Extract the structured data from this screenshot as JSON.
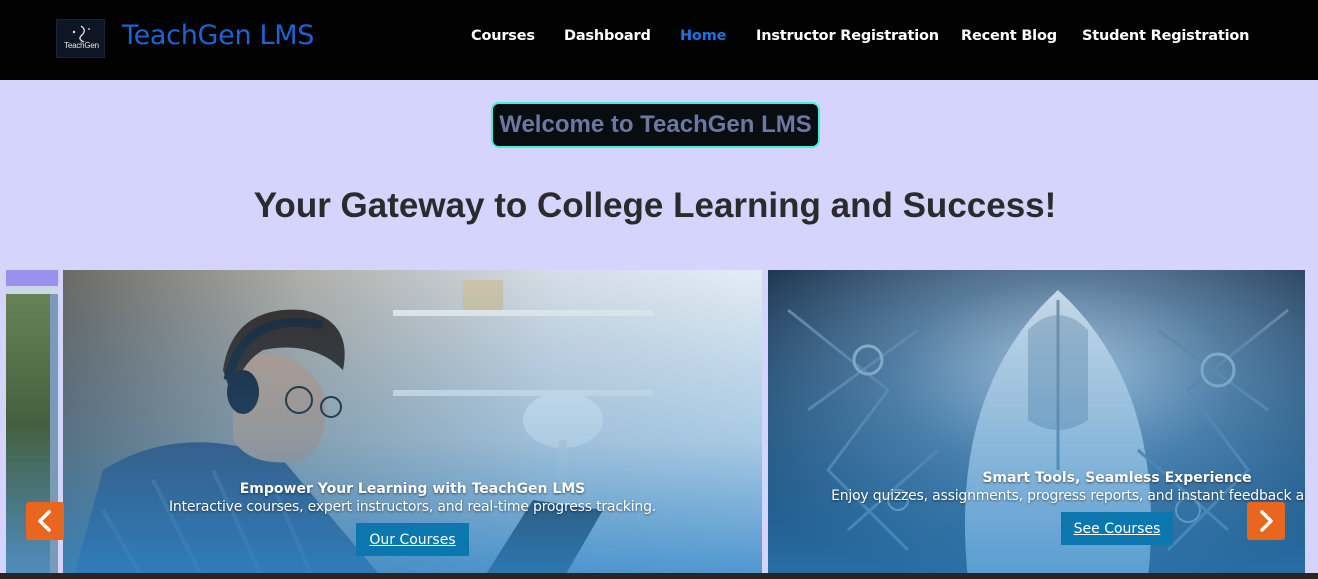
{
  "header": {
    "logo_text": "TeachGen",
    "logo_icon": "teachgen-logo-icon",
    "brand": "TeachGen LMS",
    "nav": [
      {
        "label": "Courses",
        "active": false
      },
      {
        "label": "Dashboard",
        "active": false
      },
      {
        "label": "Home",
        "active": true
      },
      {
        "label": "Instructor Registration",
        "active": false
      },
      {
        "label": "Recent Blog",
        "active": false
      },
      {
        "label": "Student Registration",
        "active": false
      }
    ]
  },
  "hero": {
    "badge": "Welcome to TeachGen LMS",
    "tagline": "Your Gateway to College Learning and Success!"
  },
  "carousel": {
    "slides": [
      {
        "title": "Empower Your Learning with TeachGen LMS",
        "text": "Interactive courses, expert instructors, and real-time progress tracking.",
        "button": "Our Courses",
        "image": "student-with-headphones-photo"
      },
      {
        "title": "Smart Tools, Seamless Experience",
        "text": "Enjoy quizzes, assignments, progress reports, and instant feedback all in one place.",
        "button": "See Courses",
        "image": "robot-helmet-photo"
      }
    ],
    "prev_icon": "chevron-left-icon",
    "next_icon": "chevron-right-icon"
  },
  "colors": {
    "page_bg": "#d4d4fd",
    "header_bg": "#020202",
    "brand": "#1e63d6",
    "nav_active": "#1a73e8",
    "badge_border": "#3ff0e2",
    "button_bg": "#0c77ae",
    "arrow_bg": "#e8661e"
  }
}
